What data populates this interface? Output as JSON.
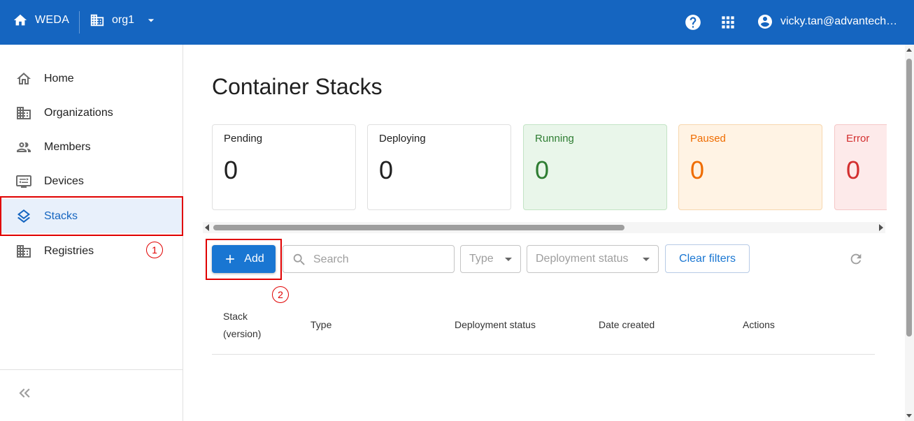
{
  "topbar": {
    "home_label": "WEDA",
    "org_label": "org1",
    "user_label": "vicky.tan@advantech.com"
  },
  "sidebar": {
    "items": [
      {
        "label": "Home",
        "icon": "home-icon"
      },
      {
        "label": "Organizations",
        "icon": "building-icon"
      },
      {
        "label": "Members",
        "icon": "people-icon"
      },
      {
        "label": "Devices",
        "icon": "monitor-icon"
      },
      {
        "label": "Stacks",
        "icon": "layers-icon"
      },
      {
        "label": "Registries",
        "icon": "building-icon"
      }
    ],
    "active": "Stacks"
  },
  "annotations": {
    "one": "1",
    "two": "2"
  },
  "main": {
    "title": "Container Stacks",
    "status_cards": [
      {
        "label": "Pending",
        "value": "0"
      },
      {
        "label": "Deploying",
        "value": "0"
      },
      {
        "label": "Running",
        "value": "0"
      },
      {
        "label": "Paused",
        "value": "0"
      },
      {
        "label": "Error",
        "value": "0"
      }
    ],
    "toolbar": {
      "add_label": "Add",
      "search_placeholder": "Search",
      "type_label": "Type",
      "deployment_status_label": "Deployment status",
      "clear_filters_label": "Clear filters"
    },
    "table": {
      "columns": [
        "Stack\n(version)",
        "Type",
        "Deployment status",
        "Date created",
        "Actions"
      ]
    }
  },
  "colors": {
    "topbar": "#1565c0",
    "primary": "#1976d2",
    "running": "#2e7d32",
    "paused": "#ef6c00",
    "error": "#d32f2f",
    "annotation": "#e00000"
  }
}
